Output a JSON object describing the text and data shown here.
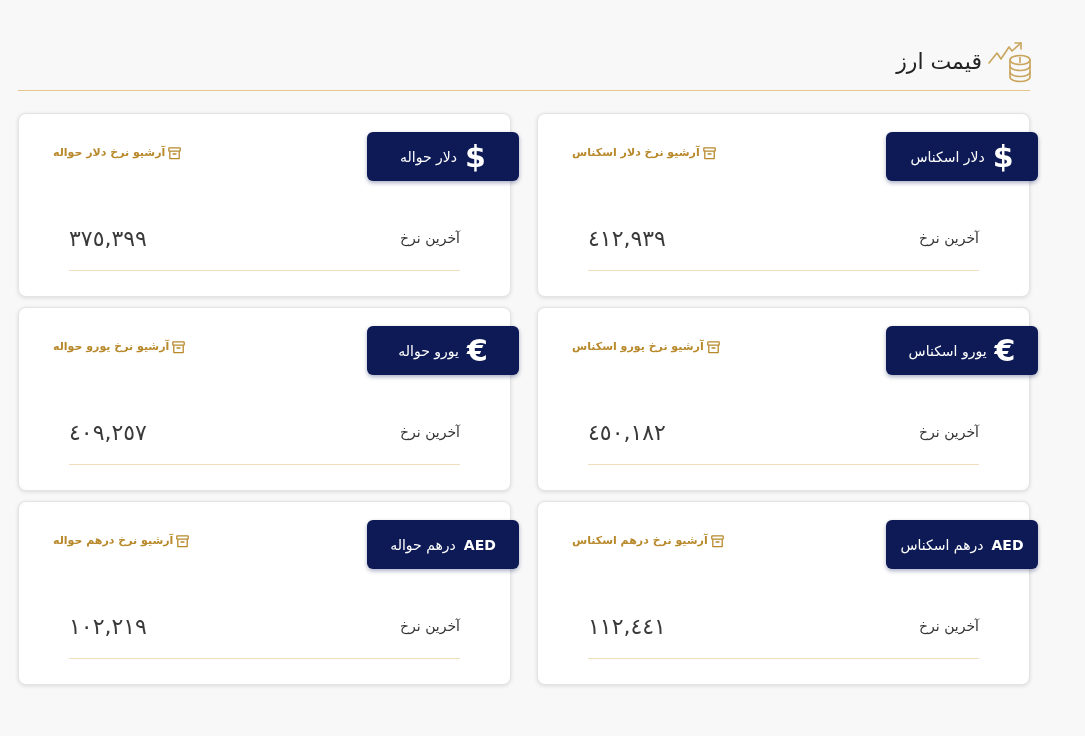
{
  "header": {
    "title": "قیمت ارز"
  },
  "cards": [
    {
      "badge": {
        "symbol": {
          "text": "$",
          "kind": "sign"
        },
        "label": "دلار اسکناس"
      },
      "archive_link": "آرشیو نرخ دلار اسکناس",
      "rate_label": "آخرین نرخ",
      "rate_value": "٤١٢,٩٣٩"
    },
    {
      "badge": {
        "symbol": {
          "text": "$",
          "kind": "sign"
        },
        "label": "دلار حواله"
      },
      "archive_link": "آرشیو نرخ دلار حواله",
      "rate_label": "آخرین نرخ",
      "rate_value": "٣٧٥,٣٩٩"
    },
    {
      "badge": {
        "symbol": {
          "text": "€",
          "kind": "sign"
        },
        "label": "یورو اسکناس"
      },
      "archive_link": "آرشیو نرخ یورو اسکناس",
      "rate_label": "آخرین نرخ",
      "rate_value": "٤٥٠,١٨٢"
    },
    {
      "badge": {
        "symbol": {
          "text": "€",
          "kind": "sign"
        },
        "label": "یورو حواله"
      },
      "archive_link": "آرشیو نرخ یورو حواله",
      "rate_label": "آخرین نرخ",
      "rate_value": "٤٠٩,٢٥٧"
    },
    {
      "badge": {
        "symbol": {
          "text": "AED",
          "kind": "code"
        },
        "label": "درهم اسکناس"
      },
      "archive_link": "آرشیو نرخ درهم اسکناس",
      "rate_label": "آخرین نرخ",
      "rate_value": "١١٢,٤٤١"
    },
    {
      "badge": {
        "symbol": {
          "text": "AED",
          "kind": "code"
        },
        "label": "درهم حواله"
      },
      "archive_link": "آرشیو نرخ درهم حواله",
      "rate_label": "آخرین نرخ",
      "rate_value": "١٠٢,٢١٩"
    }
  ]
}
